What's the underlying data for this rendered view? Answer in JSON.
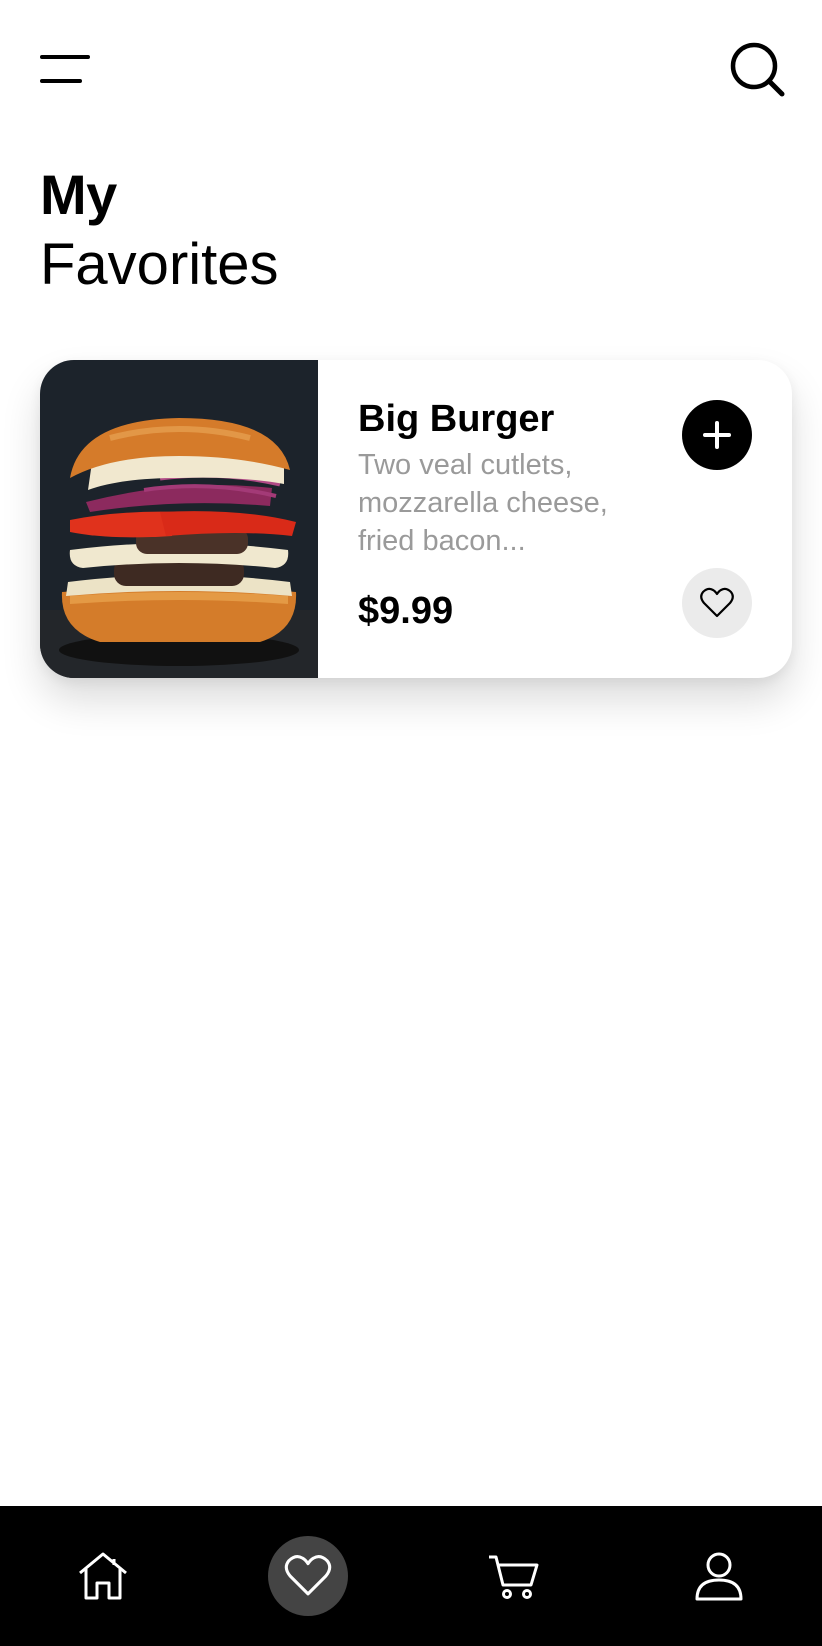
{
  "header": {
    "menu_icon": "menu-icon",
    "search_icon": "search-icon"
  },
  "title": {
    "line1": "My",
    "line2": "Favorites"
  },
  "favorites": [
    {
      "name": "Big Burger",
      "description": "Two veal cutlets, mozzarella cheese, fried bacon...",
      "price": "$9.99",
      "image_icon": "burger-image",
      "add_icon": "plus-icon",
      "favorite_icon": "heart-icon"
    }
  ],
  "bottom_nav": {
    "items": [
      {
        "icon": "home-icon",
        "active": false
      },
      {
        "icon": "heart-icon",
        "active": true
      },
      {
        "icon": "cart-icon",
        "active": false
      },
      {
        "icon": "user-icon",
        "active": false
      }
    ]
  },
  "colors": {
    "accent": "#000000",
    "nav_background": "#000000",
    "nav_active": "#444444",
    "description_text": "#9a9a9a",
    "favorite_button_bg": "#ebebeb"
  }
}
